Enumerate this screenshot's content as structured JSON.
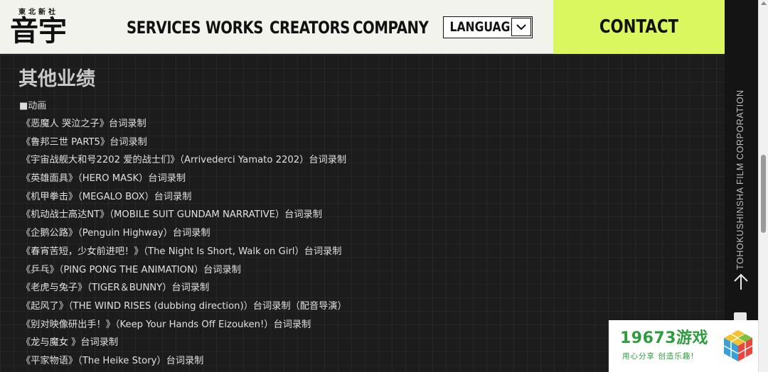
{
  "header": {
    "logo_small": "東北新社",
    "logo_big": "音宇",
    "nav": [
      {
        "label": "SERVICES"
      },
      {
        "label": "WORKS"
      },
      {
        "label": "CREATORS"
      },
      {
        "label": "COMPANY"
      }
    ],
    "language_label": "LANGUAGE",
    "contact_label": "CONTACT"
  },
  "main": {
    "section_title": "其他业绩",
    "category": "■动画",
    "works": [
      "《恶魔人 哭泣之子》台词录制",
      "《鲁邦三世 PART5》台词录制",
      "《宇宙战舰大和号2202 爱的战士们》（Arrivederci Yamato 2202）台词录制",
      "《英雄面具》（HERO MASK）台词录制",
      "《机甲拳击》（MEGALO BOX）台词录制",
      "《机动战士高达NT》（MOBILE SUIT GUNDAM NARRATIVE）台词录制",
      "《企鹅公路》（Penguin Highway）台词录制",
      "《春宵苦短，少女前进吧！》（The Night Is Short, Walk on Girl）台词录制",
      "《乒乓》（PING PONG THE ANIMATION）台词录制",
      "《老虎与兔子》（TIGER＆BUNNY）台词录制",
      "《起风了》（THE WIND RISES (dubbing direction)）台词录制（配音导演）",
      "《别对映像研出手！》（Keep Your Hands Off Eizouken!）台词录制",
      "《龙与魔女 》台词录制",
      "《平家物语》（The Heike Story）台词录制"
    ]
  },
  "rail": {
    "vertical_text": "TOHOKUSHINSHA FILM CORPORATION"
  },
  "watermark": {
    "title": "19673游戏",
    "subtitle": "用心分享 创造乐趣!"
  },
  "colors": {
    "header_bg": "#f3f3ee",
    "contact_bg": "#dbf760",
    "main_bg": "#1c1c1c",
    "watermark_green": "#2d9c3f"
  }
}
